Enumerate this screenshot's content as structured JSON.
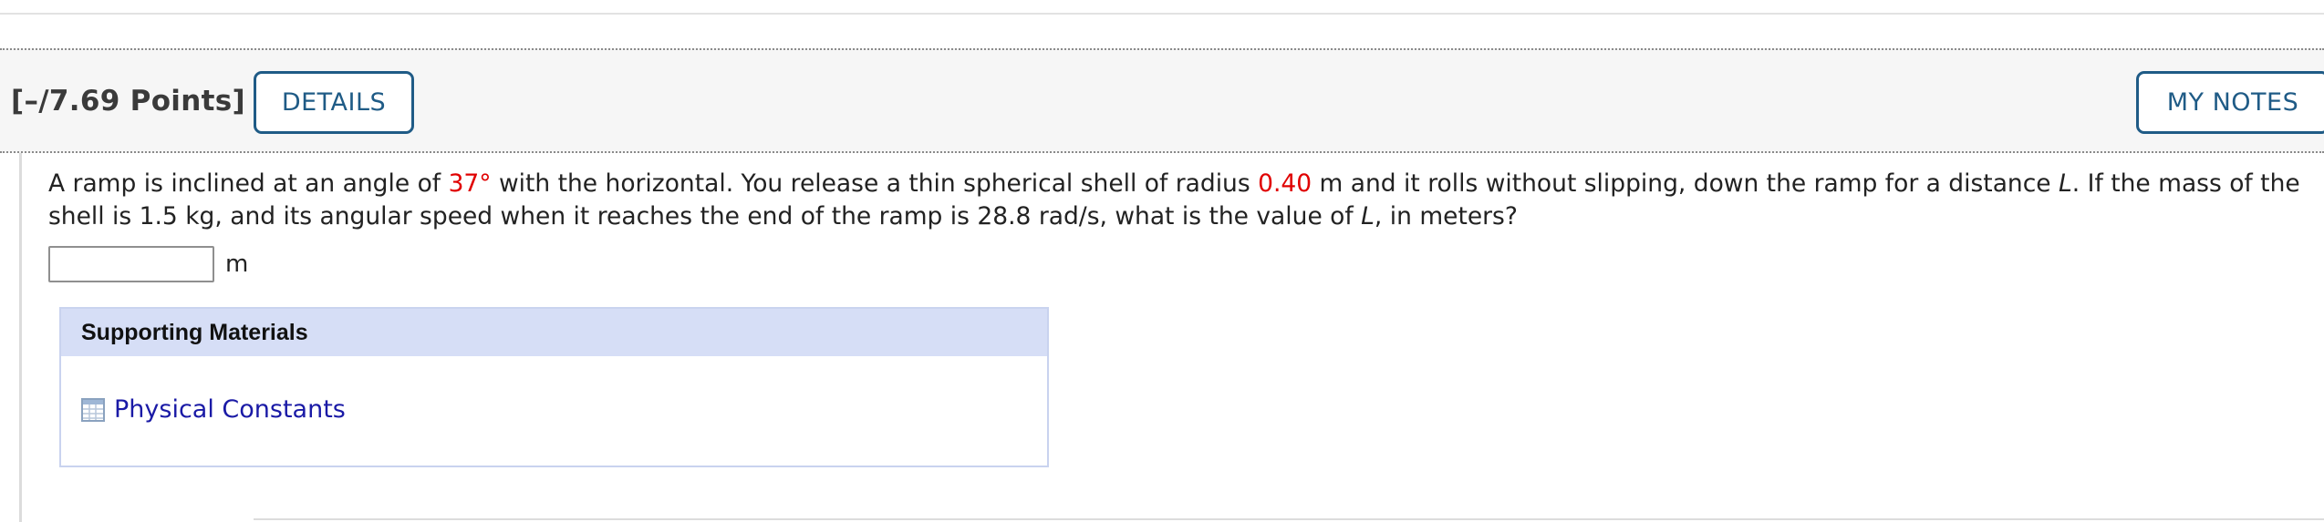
{
  "header": {
    "points": "[–/7.69 Points]",
    "details_label": "DETAILS",
    "notes_label": "MY NOTES"
  },
  "question": {
    "text_1": "A ramp is inclined at an angle of ",
    "angle": "37°",
    "text_2": " with the horizontal. You release a thin spherical shell of radius ",
    "radius": "0.40",
    "text_3": " m and it rolls without slipping, down the ramp for a distance ",
    "var_L1": "L",
    "text_4": ". If the mass of the shell is 1.5 kg, and its angular speed when it reaches the end of the ramp is 28.8 rad/s, what is the value of ",
    "var_L2": "L",
    "text_5": ", in meters?",
    "highlight_color": "#e00000"
  },
  "answer": {
    "value": "",
    "unit": "m"
  },
  "support": {
    "title": "Supporting Materials",
    "link_label": "Physical Constants",
    "link_icon": "table-icon"
  }
}
